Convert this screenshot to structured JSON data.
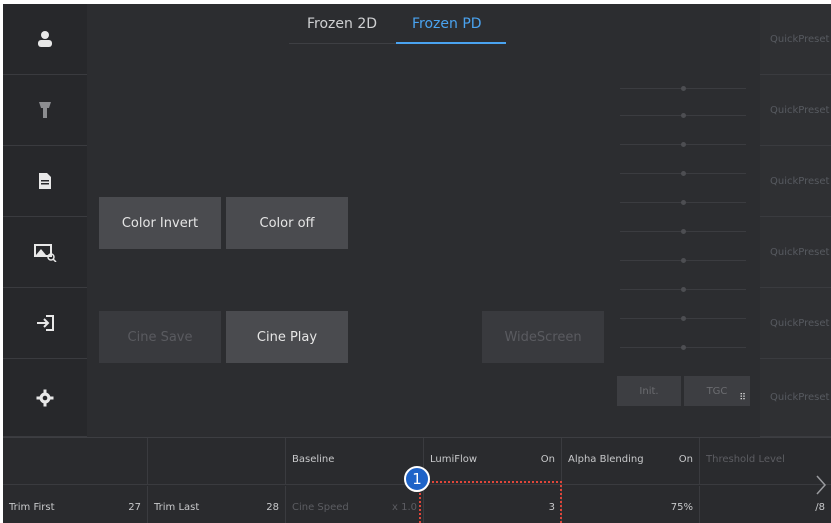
{
  "tabs": [
    {
      "label": "Frozen 2D",
      "active": false
    },
    {
      "label": "Frozen PD",
      "active": true
    }
  ],
  "sidebar": {
    "items": [
      {
        "icon": "person-icon"
      },
      {
        "icon": "probe-icon"
      },
      {
        "icon": "document-icon"
      },
      {
        "icon": "image-search-icon"
      },
      {
        "icon": "exit-icon"
      },
      {
        "icon": "gear-icon"
      }
    ]
  },
  "buttons": {
    "color_invert": "Color Invert",
    "color_off": "Color off",
    "cine_save": "Cine Save",
    "cine_play": "Cine Play",
    "widescreen": "WideScreen",
    "init": "Init.",
    "tgc": "TGC"
  },
  "quickpresets": [
    "QuickPreset",
    "QuickPreset",
    "QuickPreset",
    "QuickPreset",
    "QuickPreset",
    "QuickPreset"
  ],
  "bottom": {
    "row1": [
      {
        "label": "",
        "value": ""
      },
      {
        "label": "",
        "value": ""
      },
      {
        "label": "Baseline",
        "value": ""
      },
      {
        "label": "LumiFlow",
        "value": "On"
      },
      {
        "label": "Alpha Blending",
        "value": "On"
      },
      {
        "label": "Threshold Level",
        "value": ""
      }
    ],
    "row2": [
      {
        "label": "Trim First",
        "value": "27"
      },
      {
        "label": "Trim Last",
        "value": "28"
      },
      {
        "label": "Cine Speed",
        "value": "x 1.0"
      },
      {
        "label": "",
        "value": "3"
      },
      {
        "label": "",
        "value": "75%"
      },
      {
        "label": "",
        "value": "/8"
      }
    ]
  },
  "callout": {
    "number": "1"
  },
  "colors": {
    "accent": "#4aa3f0",
    "callout_border": "#e0463a",
    "badge": "#1e63c8"
  }
}
